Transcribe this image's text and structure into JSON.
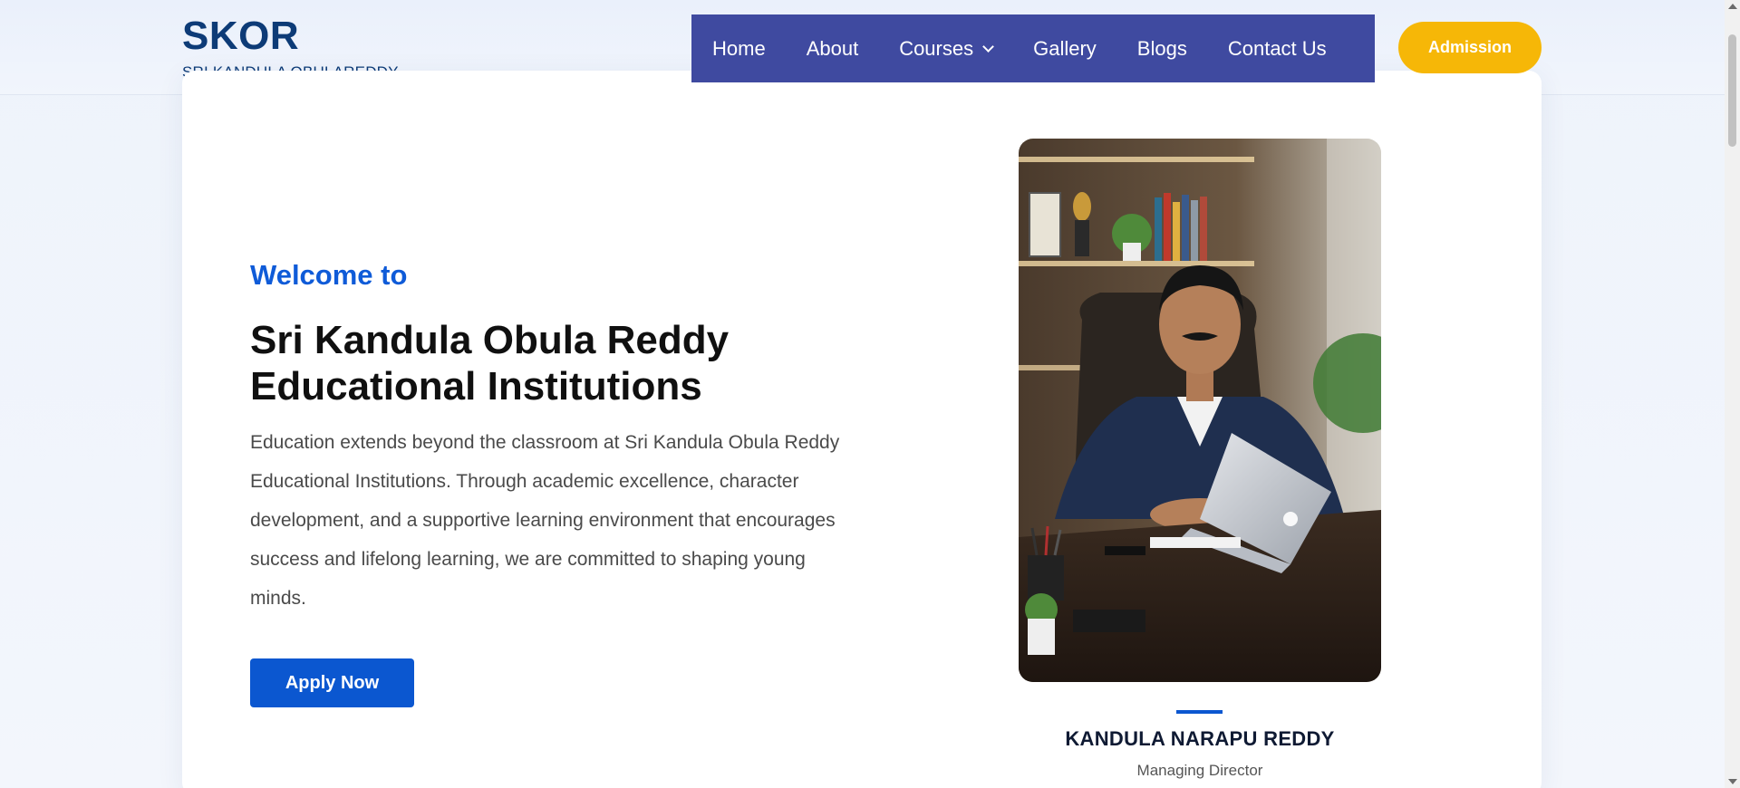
{
  "brand": {
    "title": "SKOR",
    "subtitle": "SRI KANDULA OBULAREDDY"
  },
  "nav": {
    "items": [
      {
        "label": "Home"
      },
      {
        "label": "About"
      },
      {
        "label": "Courses",
        "has_dropdown": true
      },
      {
        "label": "Gallery"
      },
      {
        "label": "Blogs"
      },
      {
        "label": "Contact Us"
      }
    ]
  },
  "admission_label": "Admission",
  "hero": {
    "welcome": "Welcome to",
    "headline_line1": "Sri Kandula Obula Reddy",
    "headline_line2": "Educational Institutions",
    "description": "Education extends beyond the classroom at Sri Kandula Obula Reddy Educational Institutions. Through academic excellence, character development, and a supportive learning environment that encourages success and lifelong learning, we are committed to shaping young minds.",
    "apply_label": "Apply Now"
  },
  "director": {
    "name": "KANDULA NARAPU REDDY",
    "role": "Managing Director",
    "photo_icon": "director-portrait"
  },
  "colors": {
    "brand": "#0d3b77",
    "nav_bg": "#3f4aa0",
    "admission_bg": "#f6b707",
    "accent_blue": "#0b57d0",
    "welcome_blue": "#0f5bd8"
  }
}
